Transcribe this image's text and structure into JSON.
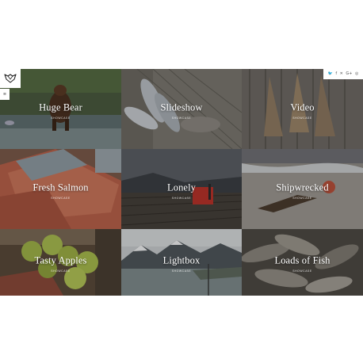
{
  "header": {
    "menu_icon": "≡",
    "social": [
      {
        "name": "twitter-icon",
        "glyph": "🐦"
      },
      {
        "name": "facebook-icon",
        "glyph": "f"
      },
      {
        "name": "xing-icon",
        "glyph": "✕"
      },
      {
        "name": "googleplus-icon",
        "glyph": "G+"
      },
      {
        "name": "dribbble-icon",
        "glyph": "◎"
      }
    ]
  },
  "tiles": [
    {
      "title": "Huge Bear",
      "sub": "Showcase"
    },
    {
      "title": "Slideshow",
      "sub": "Showcase"
    },
    {
      "title": "Video",
      "sub": "Showcase"
    },
    {
      "title": "Fresh Salmon",
      "sub": "Showcase"
    },
    {
      "title": "Lonely",
      "sub": "Showcase"
    },
    {
      "title": "Shipwrecked",
      "sub": "Showcase"
    },
    {
      "title": "Tasty Apples",
      "sub": "Showcase"
    },
    {
      "title": "Lightbox",
      "sub": "Showcase"
    },
    {
      "title": "Loads of Fish",
      "sub": "Showcase"
    }
  ]
}
